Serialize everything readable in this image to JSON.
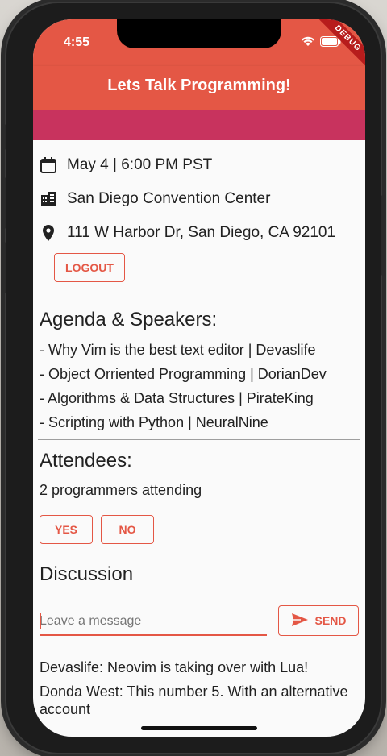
{
  "status_bar": {
    "time": "4:55",
    "debug_banner": "DEBUG"
  },
  "app_bar": {
    "title": "Lets Talk Programming!"
  },
  "event": {
    "date": "May 4 | 6:00 PM PST",
    "venue": "San Diego Convention Center",
    "address": "111 W Harbor Dr, San Diego, CA 92101",
    "logout_label": "LOGOUT"
  },
  "agenda": {
    "title": "Agenda & Speakers:",
    "items": [
      "- Why Vim is the best text editor | Devaslife",
      "- Object Orriented Programming | DorianDev",
      "- Algorithms & Data Structures | PirateKing",
      "- Scripting with Python | NeuralNine"
    ]
  },
  "attendees": {
    "title": "Attendees:",
    "count_text": "2 programmers attending",
    "yes_label": "YES",
    "no_label": "NO"
  },
  "discussion": {
    "title": "Discussion",
    "input_placeholder": "Leave a message",
    "send_label": "SEND",
    "messages": [
      "Devaslife: Neovim is taking over with Lua!",
      "Donda West: This number 5. With an alternative account"
    ]
  },
  "colors": {
    "primary": "#e45745",
    "banner": "#c8335e",
    "background": "#fafafa"
  },
  "icons": [
    "calendar-icon",
    "building-icon",
    "location-pin-icon",
    "send-icon",
    "wifi-icon",
    "battery-icon"
  ]
}
